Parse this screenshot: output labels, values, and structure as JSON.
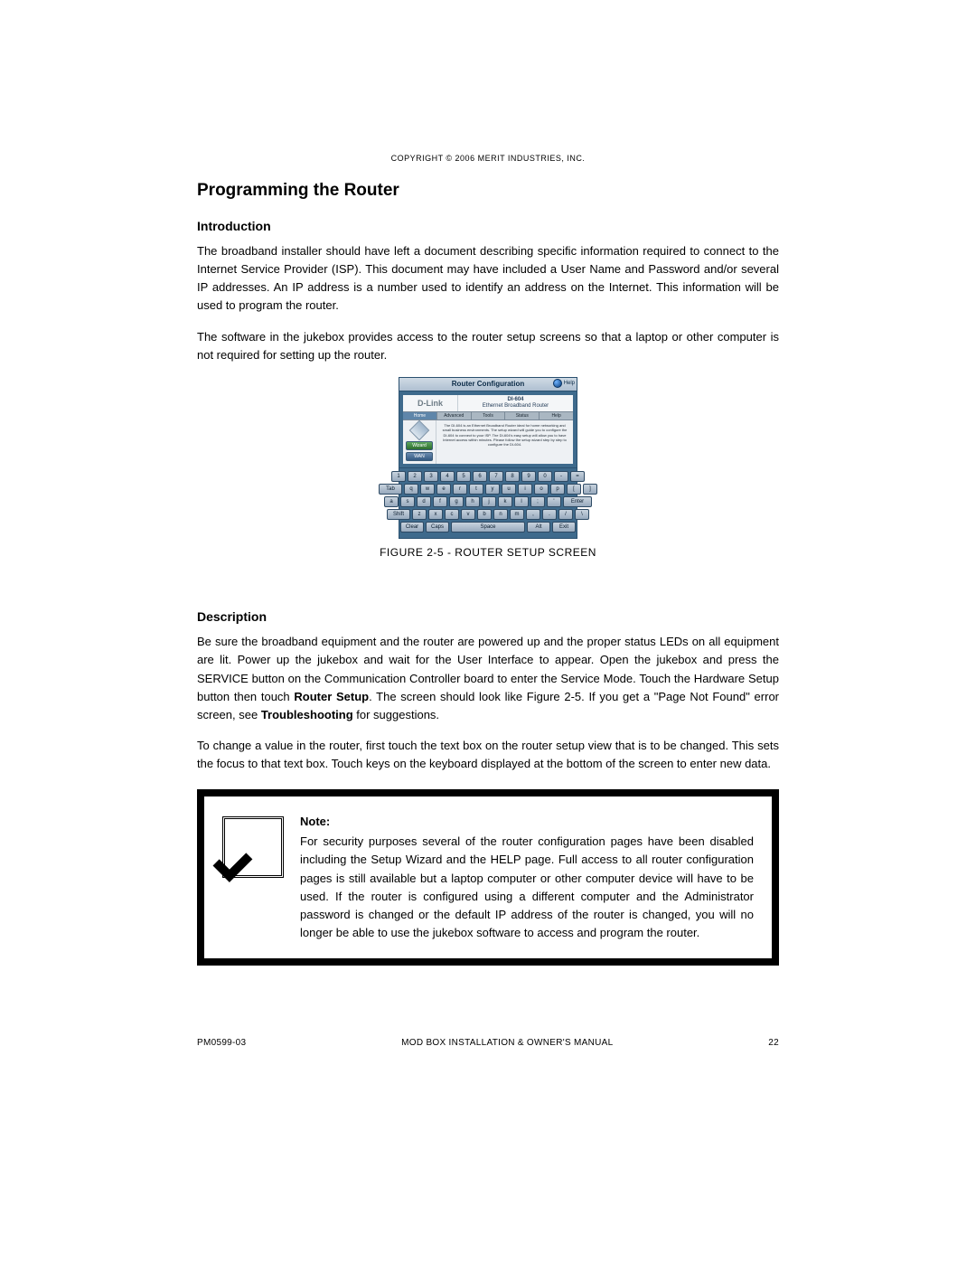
{
  "copyright": "COPYRIGHT © 2006 MERIT INDUSTRIES, INC.",
  "title": "Programming the Router",
  "intro_head": "Introduction",
  "intro_p1": "The broadband installer should have left a document describing specific information required to connect to the Internet Service Provider (ISP).  This document may have included a User Name and Password and/or several IP addresses.  An IP address is a number used to identify an address on the Internet.  This information will be used to program the router.",
  "intro_p2": "The software in the jukebox provides access to the router setup screens so that a laptop or other computer is not required for setting up the router.",
  "figure_caption": "FIGURE 2-5 - ROUTER SETUP SCREEN",
  "desc_head": "Description",
  "desc_p1_a": "Be sure the broadband equipment and the router are powered up and the proper status LEDs on all equipment are lit.  Power up the jukebox and wait for the User Interface to appear.  Open the jukebox and press the SERVICE button on the Communication Controller board to enter the Service Mode.  Touch the Hardware Setup button then touch ",
  "desc_p1_bold1": "Router Setup",
  "desc_p1_b": ".  The screen should look like Figure 2-5.  If you get a \"Page Not Found\" error screen, see ",
  "desc_p1_bold2": "Troubleshooting",
  "desc_p1_c": " for suggestions.",
  "desc_p2": "To change a value in the router, first touch the text box on the router setup view that is to be changed.  This sets the focus to that text box.  Touch keys on the keyboard displayed at the bottom of the screen to enter new data.",
  "note_label": "Note:",
  "note_body": "For security purposes several of the router configuration pages have been disabled including the Setup Wizard and the HELP page.  Full access to all router configuration pages is still available but a laptop computer or other computer device will have to be used.  If the router is configured using a different computer and the Administrator password is changed or the default IP address of the router is changed, you will no longer be able to use the jukebox software to access and program the router.",
  "footer_left": "PM0599-03",
  "footer_center": "MOD BOX INSTALLATION & OWNER'S MANUAL",
  "footer_right": "22",
  "fig": {
    "title": "Router Configuration",
    "help": "Help",
    "brand": "D-Link",
    "model": "DI-604",
    "model_sub": "Ethernet Broadband Router",
    "tabs": [
      "Home",
      "Advanced",
      "Tools",
      "Status",
      "Help"
    ],
    "side_btns": [
      "Wizard",
      "WAN"
    ],
    "content": "The DI-604 is an Ethernet Broadband Router ideal for home networking and small business environments. The setup wizard will guide you to configure the DI-604 to connect to your ISP. The DI-604's easy setup will allow you to have Internet access within minutes. Please follow the setup wizard step by step to configure the DI-604.",
    "kbd_rows": [
      [
        "1",
        "2",
        "3",
        "4",
        "5",
        "6",
        "7",
        "8",
        "9",
        "0",
        "-",
        "="
      ],
      [
        "Tab",
        "q",
        "w",
        "e",
        "r",
        "t",
        "y",
        "u",
        "i",
        "o",
        "p",
        "[",
        "]"
      ],
      [
        "a",
        "s",
        "d",
        "f",
        "g",
        "h",
        "j",
        "k",
        "l",
        ";",
        "'",
        "Enter"
      ],
      [
        "Shift",
        "z",
        "x",
        "c",
        "v",
        "b",
        "n",
        "m",
        ",",
        ".",
        "/",
        "\\"
      ],
      [
        "Clear",
        "Caps",
        "Space",
        "Alt",
        "Exit"
      ]
    ]
  }
}
